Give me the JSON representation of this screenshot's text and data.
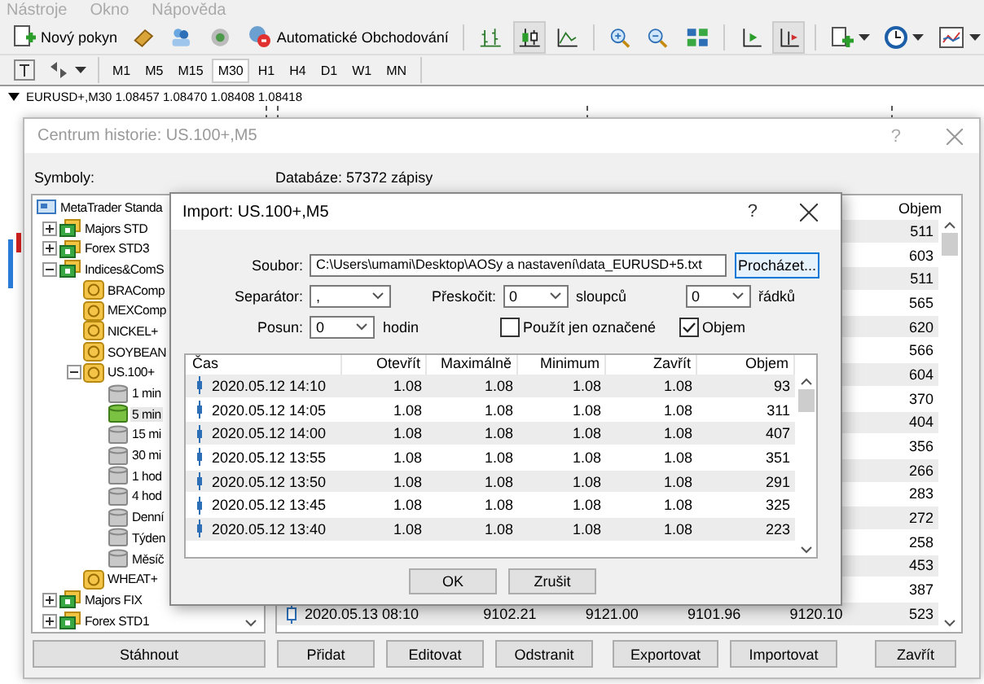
{
  "menu": [
    "Nástroje",
    "Okno",
    "Nápověda"
  ],
  "toolbar": {
    "new_order": "Nový pokyn",
    "auto_trading": "Automatické Obchodování"
  },
  "timeframes": [
    {
      "label": "M1",
      "selected": false
    },
    {
      "label": "M5",
      "selected": false
    },
    {
      "label": "M15",
      "selected": false
    },
    {
      "label": "M30",
      "selected": true
    },
    {
      "label": "H1",
      "selected": false
    },
    {
      "label": "H4",
      "selected": false
    },
    {
      "label": "D1",
      "selected": false
    },
    {
      "label": "W1",
      "selected": false
    },
    {
      "label": "MN",
      "selected": false
    }
  ],
  "chart": {
    "title": "EURUSD+,M30  1.08457 1.08470 1.08408 1.08418"
  },
  "history_window": {
    "title": "Centrum historie: US.100+,M5",
    "help": "?",
    "symbols_label": "Symboly:",
    "database": "Databáze: 57372 zápisy",
    "tree": [
      {
        "label": "MetaTrader Standa",
        "kind": "root",
        "selected": false,
        "children": [
          {
            "label": "Majors STD",
            "kind": "group",
            "expanded": false,
            "selected": false
          },
          {
            "label": "Forex STD3",
            "kind": "group",
            "expanded": false,
            "selected": false
          },
          {
            "label": "Indices&ComS",
            "kind": "group",
            "expanded": true,
            "selected": false,
            "children": [
              {
                "label": "BRAComp",
                "kind": "symbol",
                "selected": false
              },
              {
                "label": "MEXComp",
                "kind": "symbol",
                "selected": false
              },
              {
                "label": "NICKEL+",
                "kind": "symbol",
                "selected": false
              },
              {
                "label": "SOYBEAN",
                "kind": "symbol",
                "selected": false
              },
              {
                "label": "US.100+",
                "kind": "symbol",
                "expanded": true,
                "selected": false,
                "children": [
                  {
                    "label": "1 min",
                    "kind": "period",
                    "selected": false
                  },
                  {
                    "label": "5 min",
                    "kind": "period",
                    "selected": true
                  },
                  {
                    "label": "15 mi",
                    "kind": "period",
                    "selected": false
                  },
                  {
                    "label": "30 mi",
                    "kind": "period",
                    "selected": false
                  },
                  {
                    "label": "1 hod",
                    "kind": "period",
                    "selected": false
                  },
                  {
                    "label": "4 hod",
                    "kind": "period",
                    "selected": false
                  },
                  {
                    "label": "Denní",
                    "kind": "period",
                    "selected": false
                  },
                  {
                    "label": "Týden",
                    "kind": "period",
                    "selected": false
                  },
                  {
                    "label": "Měsíč",
                    "kind": "period",
                    "selected": false
                  }
                ]
              },
              {
                "label": "WHEAT+",
                "kind": "symbol",
                "selected": false
              }
            ]
          },
          {
            "label": "Majors FIX",
            "kind": "group",
            "expanded": false,
            "selected": false
          },
          {
            "label": "Forex STD1",
            "kind": "group",
            "expanded": false,
            "selected": false
          }
        ]
      }
    ],
    "table": {
      "columns": [
        "Objem"
      ],
      "rows": [
        {
          "volume": "511"
        },
        {
          "volume": "603"
        },
        {
          "volume": "511"
        },
        {
          "volume": "565"
        },
        {
          "volume": "620"
        },
        {
          "volume": "566"
        },
        {
          "volume": "604"
        },
        {
          "volume": "370"
        },
        {
          "volume": "404"
        },
        {
          "volume": "356"
        },
        {
          "volume": "266"
        },
        {
          "volume": "283"
        },
        {
          "volume": "272"
        },
        {
          "volume": "258"
        },
        {
          "volume": "453"
        },
        {
          "volume": "387"
        },
        {
          "time": "2020.05.13 08:10",
          "open": "9102.21",
          "high": "9121.00",
          "low": "9101.96",
          "close": "9120.10",
          "volume": "523"
        }
      ]
    },
    "buttons": [
      "Stáhnout",
      "Přidat",
      "Editovat",
      "Odstranit",
      "Exportovat",
      "Importovat",
      "Zavřít"
    ]
  },
  "import_dialog": {
    "title": "Import: US.100+,M5",
    "help": "?",
    "file_label": "Soubor:",
    "file_path": "C:\\Users\\umami\\Desktop\\AOSy a nastavení\\data_EURUSD+5.txt",
    "browse": "Procházet...",
    "separator_label": "Separátor:",
    "separator": ",",
    "skip_label": "Přeskočit:",
    "skip_columns": "0",
    "columns_unit": "sloupců",
    "skip_rows": "0",
    "rows_unit": "řádků",
    "shift_label": "Posun:",
    "shift": "0",
    "shift_unit": "hodin",
    "checkboxes": [
      {
        "label": "Použít jen označené",
        "checked": false
      },
      {
        "label": "Objem",
        "checked": true
      }
    ],
    "table": {
      "columns": [
        "Čas",
        "Otevřít",
        "Maximálně",
        "Minimum",
        "Zavřít",
        "Objem"
      ],
      "rows": [
        [
          "2020.05.12 14:10",
          "1.08",
          "1.08",
          "1.08",
          "1.08",
          "93"
        ],
        [
          "2020.05.12 14:05",
          "1.08",
          "1.08",
          "1.08",
          "1.08",
          "311"
        ],
        [
          "2020.05.12 14:00",
          "1.08",
          "1.08",
          "1.08",
          "1.08",
          "407"
        ],
        [
          "2020.05.12 13:55",
          "1.08",
          "1.08",
          "1.08",
          "1.08",
          "351"
        ],
        [
          "2020.05.12 13:50",
          "1.08",
          "1.08",
          "1.08",
          "1.08",
          "291"
        ],
        [
          "2020.05.12 13:45",
          "1.08",
          "1.08",
          "1.08",
          "1.08",
          "325"
        ],
        [
          "2020.05.12 13:40",
          "1.08",
          "1.08",
          "1.08",
          "1.08",
          "223"
        ]
      ]
    },
    "buttons": [
      "OK",
      "Zrušit"
    ]
  }
}
